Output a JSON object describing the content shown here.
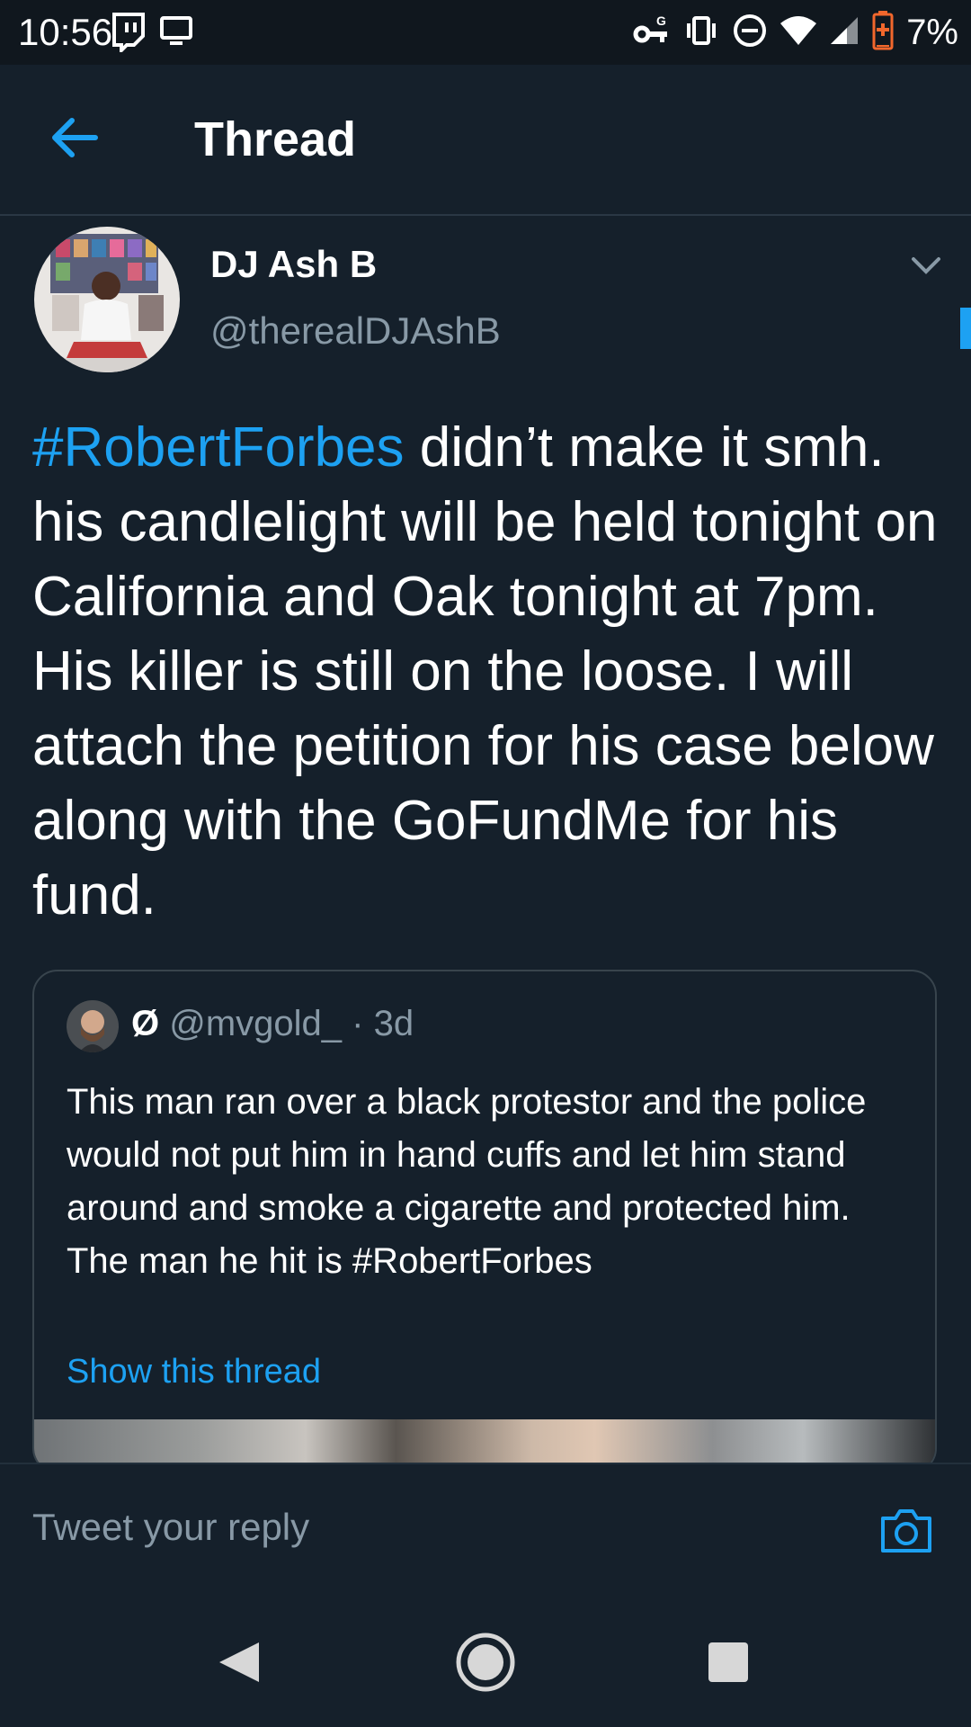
{
  "status_bar": {
    "time": "10:56",
    "battery_percent": "7%",
    "battery_level": 0.07,
    "icons": [
      "twitch-icon",
      "cast-screen-icon",
      "vpn-key-icon",
      "vibrate-icon",
      "do-not-disturb-icon",
      "wifi-icon",
      "signal-icon",
      "battery-icon"
    ]
  },
  "app_bar": {
    "title": "Thread",
    "back_icon": "arrow-left-icon"
  },
  "tweet": {
    "author_name": "DJ Ash B",
    "author_handle": "@therealDJAshB",
    "hashtag": "#RobertForbes",
    "text": " didn’t make it smh. his candlelight will be held tonight on California and Oak tonight at 7pm. His killer is still on the loose. I will attach the petition for his case below along with the GoFundMe for his fund."
  },
  "quoted_tweet": {
    "name": "Ø",
    "handle": "@mvgold_",
    "time": "3d",
    "separator": " · ",
    "text": "This man ran over a black protestor and the police would not put him in hand cuffs and let him stand around and smoke a cigarette and protected him. The man he hit is #RobertForbes",
    "show_thread_label": "Show this thread"
  },
  "reply": {
    "placeholder": "Tweet your reply",
    "camera_icon": "camera-icon"
  },
  "colors": {
    "background": "#15202b",
    "status_bar": "#10171e",
    "accent": "#1da1f2",
    "secondary_text": "#8899a6",
    "border": "#38444d"
  }
}
